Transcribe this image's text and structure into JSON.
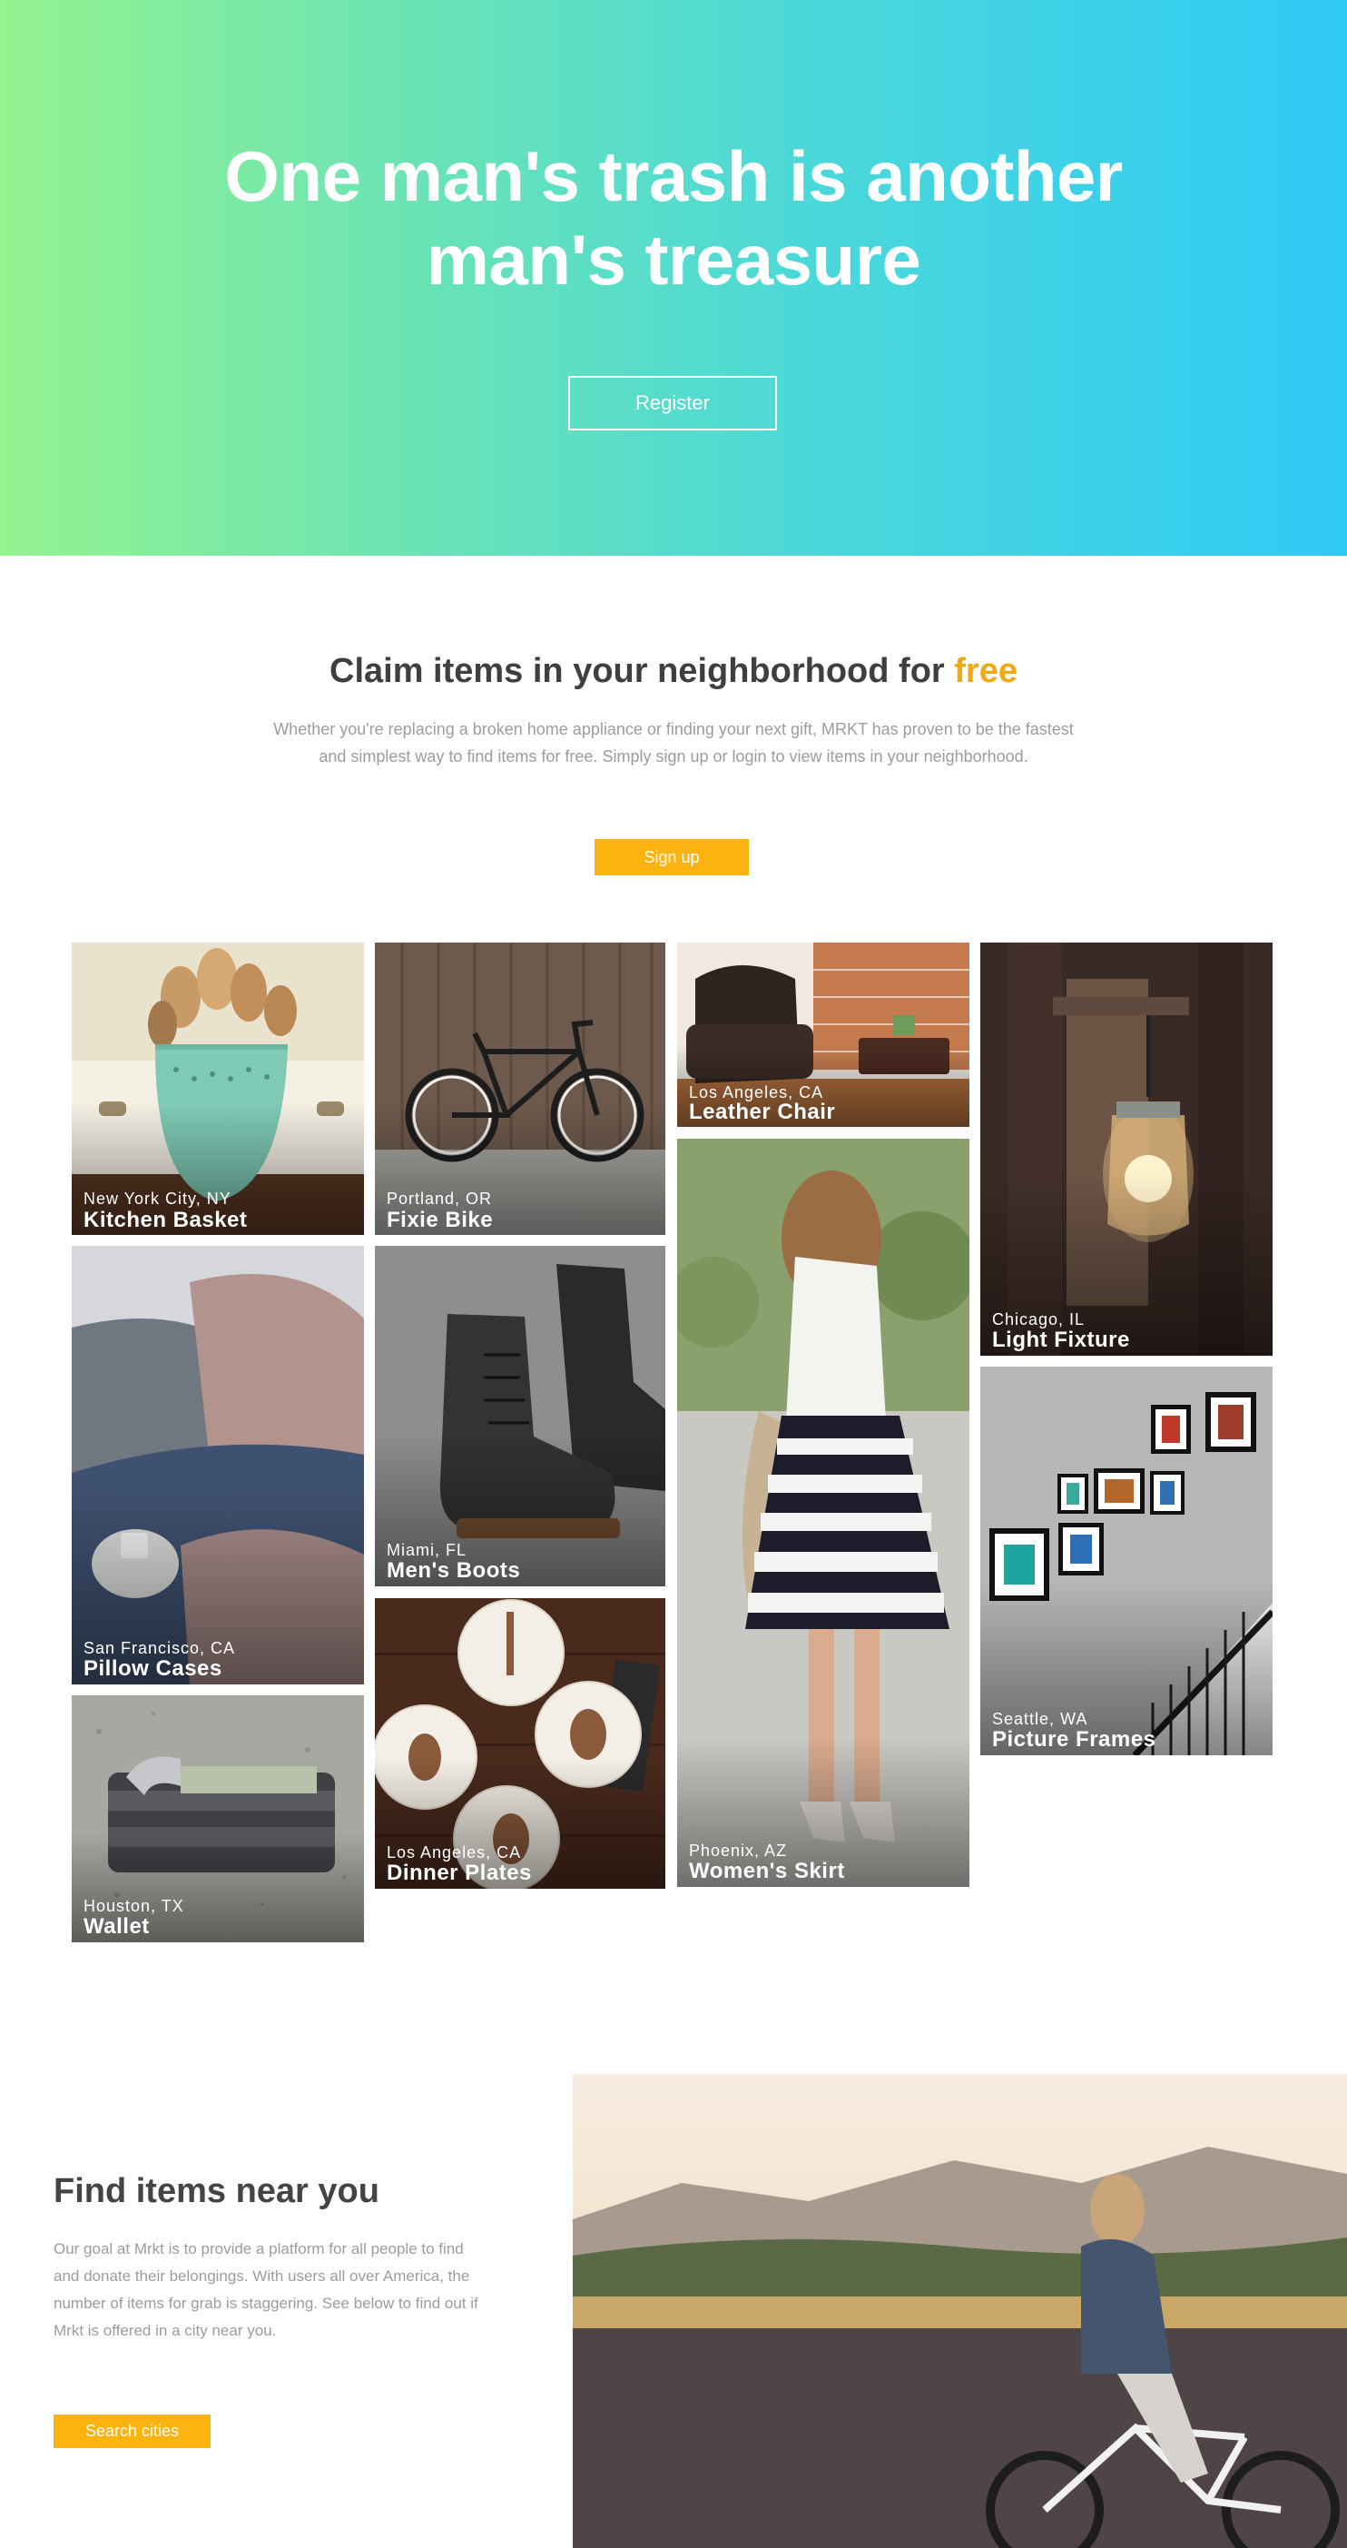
{
  "hero": {
    "title_line1": "One man's trash is another",
    "title_line2": "man's treasure",
    "register_label": "Register"
  },
  "claim": {
    "title": "Claim items in your neighborhood for",
    "title_highlight": "free",
    "description": "Whether you're replacing a broken home appliance or finding your next gift, MRKT has proven to be the fastest and simplest way to find items for free. Simply sign up or login to view items in your neighborhood.",
    "signup_label": "Sign up"
  },
  "items": [
    {
      "location": "New York City, NY",
      "name": "Kitchen Basket"
    },
    {
      "location": "Portland, OR",
      "name": "Fixie Bike"
    },
    {
      "location": "Los Angeles, CA",
      "name": "Leather Chair"
    },
    {
      "location": "Chicago, IL",
      "name": "Light Fixture"
    },
    {
      "location": "San Francisco, CA",
      "name": "Pillow Cases"
    },
    {
      "location": "Miami, FL",
      "name": "Men's Boots"
    },
    {
      "location": "Phoenix, AZ",
      "name": "Women's Skirt"
    },
    {
      "location": "Seattle, WA",
      "name": "Picture Frames"
    },
    {
      "location": "Los Angeles, CA",
      "name": "Dinner Plates"
    },
    {
      "location": "Houston, TX",
      "name": "Wallet"
    }
  ],
  "find": {
    "title": "Find items near you",
    "description": "Our goal at Mrkt is to provide a platform for all people to find and donate their belongings. With users all over America, the number of items for grab is staggering. See below to find out if Mrkt is offered in a city near you.",
    "search_label": "Search cities"
  },
  "colors": {
    "accent": "#fbb40f",
    "highlight": "#f5a70f",
    "gradient_start": "#94f28f",
    "gradient_end": "#2fcaf6"
  }
}
